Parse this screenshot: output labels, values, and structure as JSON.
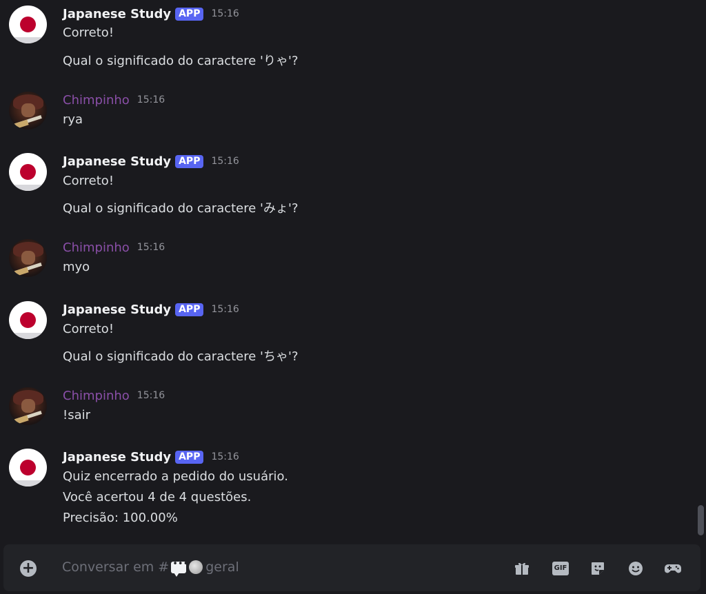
{
  "messages": [
    {
      "author": "Japanese Study",
      "badge": "APP",
      "time": "15:16",
      "lines": [
        "Correto!",
        "Qual o significado do caractere 'りゃ'?"
      ]
    },
    {
      "author": "Chimpinho",
      "time": "15:16",
      "lines": [
        "rya"
      ]
    },
    {
      "author": "Japanese Study",
      "badge": "APP",
      "time": "15:16",
      "lines": [
        "Correto!",
        "Qual o significado do caractere 'みょ'?"
      ]
    },
    {
      "author": "Chimpinho",
      "time": "15:16",
      "lines": [
        "myo"
      ]
    },
    {
      "author": "Japanese Study",
      "badge": "APP",
      "time": "15:16",
      "lines": [
        "Correto!",
        "Qual o significado do caractere 'ちゃ'?"
      ]
    },
    {
      "author": "Chimpinho",
      "time": "15:16",
      "lines": [
        "!sair"
      ]
    },
    {
      "author": "Japanese Study",
      "badge": "APP",
      "time": "15:16",
      "lines": [
        "Quiz encerrado a pedido do usuário.",
        "Você acertou 4 de 4 questões.",
        "Precisão: 100.00%"
      ]
    }
  ],
  "composer": {
    "placeholder_prefix": "Conversar em #",
    "channel": "geral"
  },
  "colors": {
    "app_badge": "#5865f2",
    "user_name": "#8a4fa8",
    "flag_red": "#bc002d"
  },
  "icons": [
    "add-attachment-icon",
    "gift-icon",
    "gif-icon",
    "sticker-icon",
    "emoji-icon",
    "activities-icon"
  ]
}
